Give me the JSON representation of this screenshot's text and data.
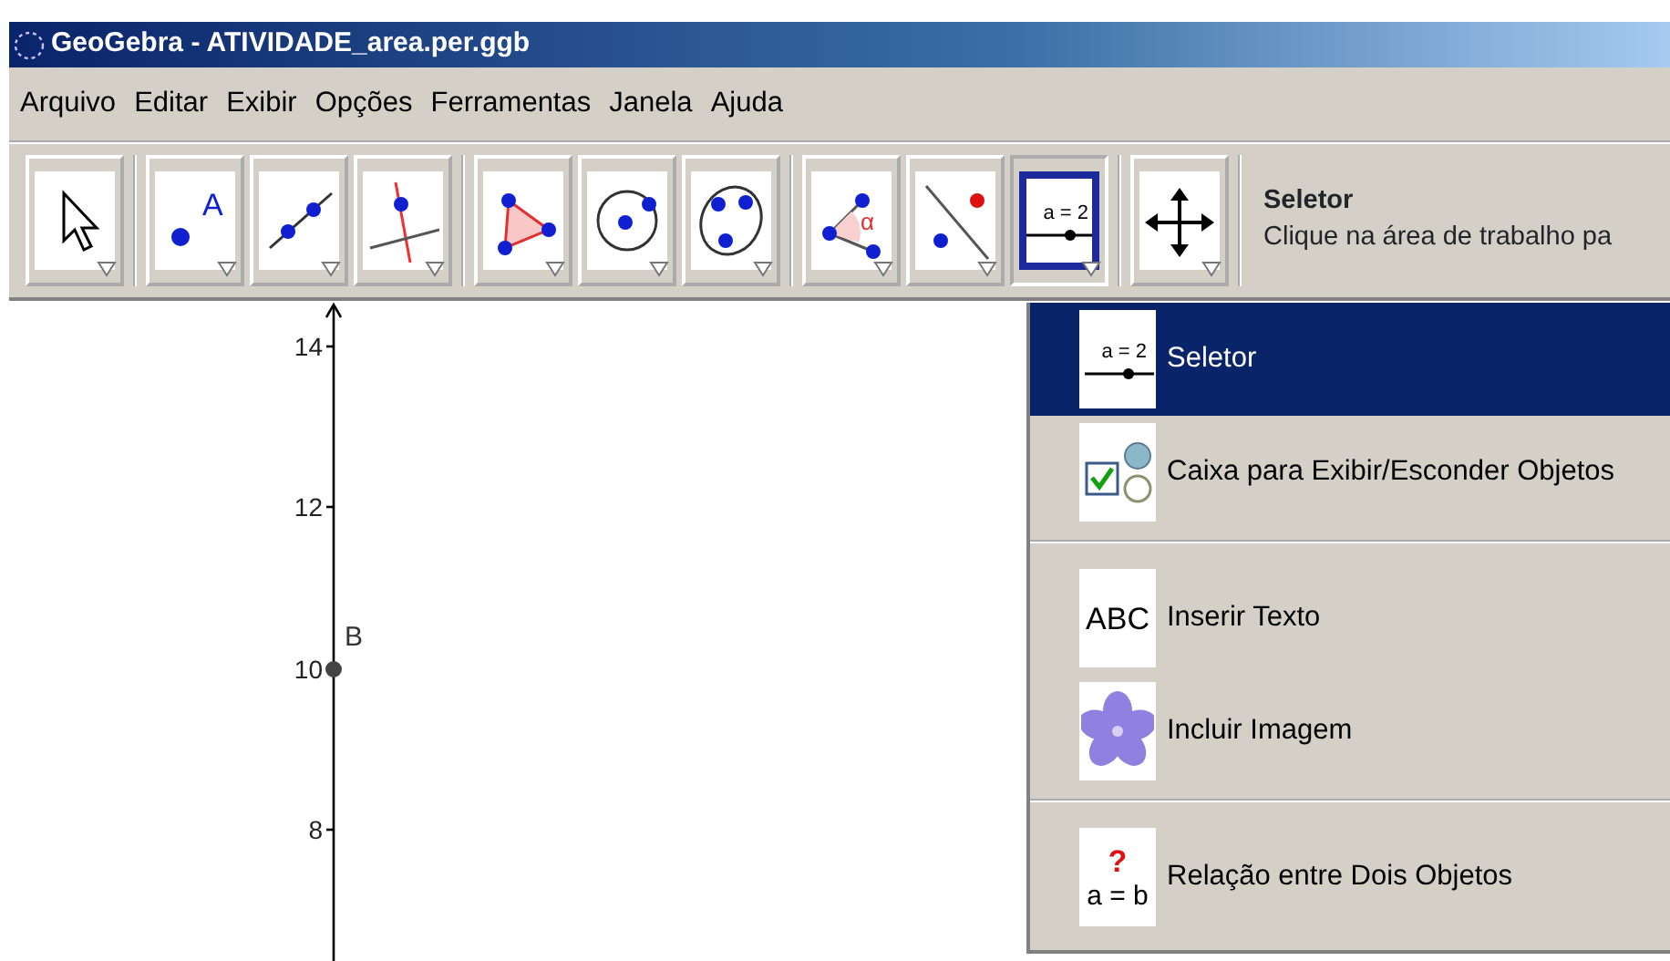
{
  "window": {
    "title": "GeoGebra - ATIVIDADE_area.per.ggb"
  },
  "menu_bar": [
    "Arquivo",
    "Editar",
    "Exibir",
    "Opções",
    "Ferramentas",
    "Janela",
    "Ajuda"
  ],
  "toolbar": {
    "groups": [
      {
        "tools": [
          {
            "kind": "move",
            "selected": false
          }
        ]
      },
      {
        "tools": [
          {
            "kind": "point",
            "glyph": "A",
            "selected": false
          },
          {
            "kind": "line",
            "selected": false
          },
          {
            "kind": "perpendicular",
            "selected": false
          }
        ]
      },
      {
        "tools": [
          {
            "kind": "polygon",
            "selected": false
          },
          {
            "kind": "circle",
            "selected": false
          },
          {
            "kind": "conic",
            "selected": false
          }
        ]
      },
      {
        "tools": [
          {
            "kind": "angle",
            "glyph": "α",
            "selected": false
          },
          {
            "kind": "reflect",
            "selected": false
          },
          {
            "kind": "slider",
            "glyph": "a = 2",
            "selected": true
          }
        ]
      },
      {
        "tools": [
          {
            "kind": "pan",
            "selected": false
          }
        ]
      }
    ]
  },
  "tool_info": {
    "title": "Seletor",
    "hint": "Clique na área de trabalho pa"
  },
  "canvas": {
    "y_ticks": [
      "14",
      "12",
      "10",
      "8"
    ],
    "points": [
      {
        "label": "B"
      }
    ]
  },
  "dropdown": {
    "groups": [
      [
        {
          "kind": "slider",
          "glyph": "a = 2",
          "label": "Seletor",
          "selected": true
        },
        {
          "kind": "checkbox",
          "label": "Caixa para Exibir/Esconder Objetos",
          "selected": false
        }
      ],
      [
        {
          "kind": "text",
          "glyph": "ABC",
          "label": "Inserir Texto",
          "selected": false
        },
        {
          "kind": "image",
          "label": "Incluir Imagem",
          "selected": false
        }
      ],
      [
        {
          "kind": "relation",
          "glyph": "? a = b",
          "label": "Relação entre Dois Objetos",
          "selected": false
        }
      ]
    ]
  }
}
